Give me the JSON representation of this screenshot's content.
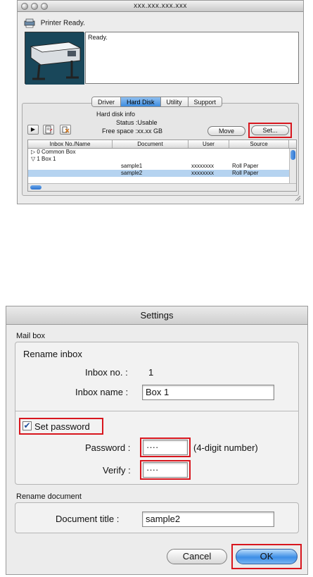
{
  "top_window": {
    "title": "xxx.xxx.xxx.xxx",
    "status_line": "Printer Ready.",
    "status_message": "Ready.",
    "tabs": [
      "Driver",
      "Hard Disk",
      "Utility",
      "Support"
    ],
    "active_tab": "Hard Disk",
    "hard_disk": {
      "heading": "Hard disk info",
      "status": "Status :Usable",
      "free_space": "Free space :xx.xx GB"
    },
    "buttons": {
      "move": "Move",
      "set": "Set..."
    },
    "table": {
      "headers": [
        "Inbox No./Name",
        "Document",
        "User",
        "Source"
      ],
      "rows": [
        {
          "name": "▷ 0 Common Box",
          "document": "",
          "user": "",
          "source": ""
        },
        {
          "name": "▽ 1 Box 1",
          "document": "",
          "user": "",
          "source": ""
        },
        {
          "name": "",
          "document": "sample1",
          "user": "xxxxxxxx",
          "source": "Roll Paper"
        },
        {
          "name": "",
          "document": "sample2",
          "user": "xxxxxxxx",
          "source": "Roll Paper"
        }
      ]
    }
  },
  "settings": {
    "title": "Settings",
    "mail_box_label": "Mail box",
    "rename_inbox_label": "Rename inbox",
    "inbox_no_label": "Inbox no. :",
    "inbox_no_value": "1",
    "inbox_name_label": "Inbox name :",
    "inbox_name_value": "Box 1",
    "set_password_label": "Set password",
    "set_password_checked": true,
    "password_label": "Password :",
    "password_value": "····",
    "password_hint": "(4-digit number)",
    "verify_label": "Verify :",
    "verify_value": "····",
    "rename_document_label": "Rename document",
    "document_title_label": "Document title :",
    "document_title_value": "sample2",
    "cancel_label": "Cancel",
    "ok_label": "OK"
  },
  "colors": {
    "highlight_red": "#d8161e",
    "active_tab_blue": "#3f8de0",
    "selected_row": "#b5d3f0"
  }
}
